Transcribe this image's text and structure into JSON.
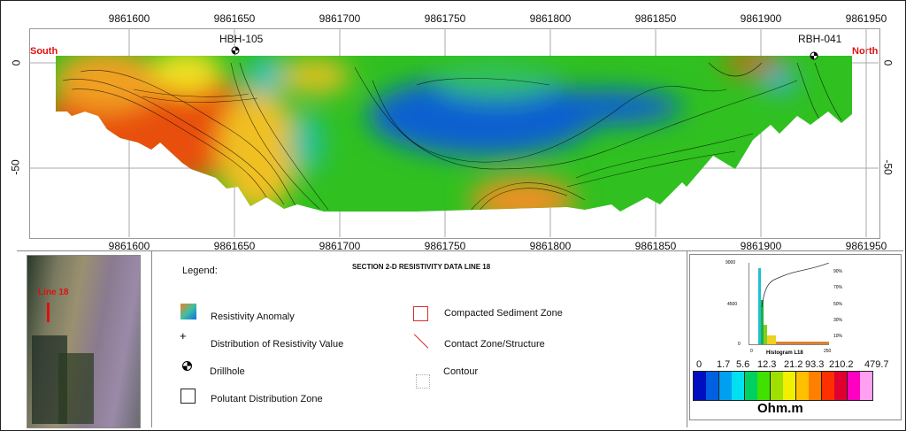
{
  "section": {
    "x_ticks": [
      "9861600",
      "9861650",
      "9861700",
      "9861750",
      "9861800",
      "9861850",
      "9861900",
      "9861950"
    ],
    "y_ticks": [
      "0",
      "-50"
    ],
    "south_label": "South",
    "north_label": "North",
    "boreholes": [
      "HBH-105",
      "RBH-041"
    ]
  },
  "location_map": {
    "line_label": "Line 18"
  },
  "legend": {
    "heading": "Legend:",
    "title": "SECTION 2-D RESISTIVITY DATA LINE 18",
    "items": [
      {
        "icon": "resistivity-anomaly-icon",
        "label": "Resistivity Anomaly"
      },
      {
        "icon": "plus-icon",
        "label": "Distribution of Resistivity Value"
      },
      {
        "icon": "drillhole-icon",
        "label": "Drillhole"
      },
      {
        "icon": "square-icon",
        "label": "Polutant Distribution Zone"
      },
      {
        "icon": "red-square-icon",
        "label": "Compacted Sediment Zone"
      },
      {
        "icon": "red-line-icon",
        "label": "Contact Zone/Structure"
      },
      {
        "icon": "contour-icon",
        "label": "Contour"
      }
    ]
  },
  "histogram": {
    "title": "Histogram L18",
    "y_ticks": [
      "9000",
      "4500",
      "0"
    ],
    "x_ticks": [
      "0",
      "250"
    ],
    "pct_ticks": [
      "90%",
      "70%",
      "50%",
      "30%",
      "10%"
    ]
  },
  "colorbar": {
    "labels": [
      "0",
      "1.7",
      "5.6",
      "12.3",
      "21.2",
      "93.3",
      "210.2",
      "479.7"
    ],
    "unit": "Ohm.m",
    "colors": [
      "#0010c0",
      "#0060e0",
      "#00a0f0",
      "#00e0f0",
      "#00d060",
      "#40e000",
      "#a0e000",
      "#f0f000",
      "#ffc000",
      "#ff8000",
      "#ff3000",
      "#e00030",
      "#ff00c0",
      "#ffa0f0"
    ]
  }
}
